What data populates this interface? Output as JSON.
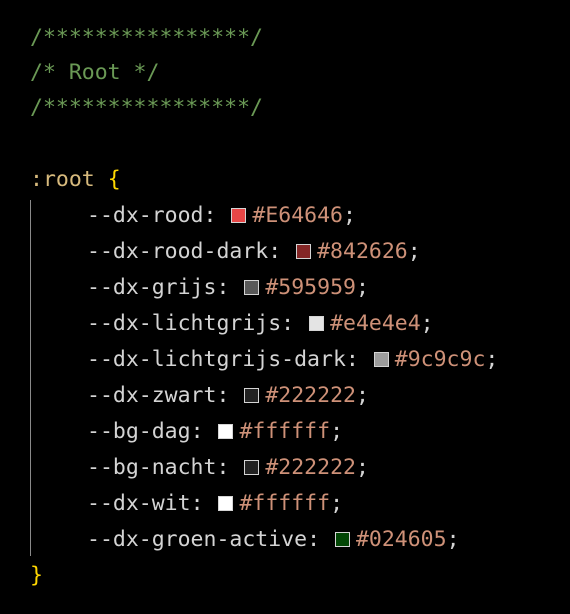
{
  "header_comments": [
    "/****************/",
    "/* Root */",
    "/****************/"
  ],
  "rule": {
    "selector": ":root",
    "open_brace": "{",
    "close_brace": "}"
  },
  "declarations": [
    {
      "property": "--dx-rood",
      "value": "#E64646",
      "color": "#E64646"
    },
    {
      "property": "--dx-rood-dark",
      "value": "#842626",
      "color": "#842626"
    },
    {
      "property": "--dx-grijs",
      "value": "#595959",
      "color": "#595959"
    },
    {
      "property": "--dx-lichtgrijs",
      "value": "#e4e4e4",
      "color": "#e4e4e4"
    },
    {
      "property": "--dx-lichtgrijs-dark",
      "value": "#9c9c9c",
      "color": "#9c9c9c"
    },
    {
      "property": "--dx-zwart",
      "value": "#222222",
      "color": "#222222"
    },
    {
      "property": "--bg-dag",
      "value": "#ffffff",
      "color": "#ffffff"
    },
    {
      "property": "--bg-nacht",
      "value": "#222222",
      "color": "#222222"
    },
    {
      "property": "--dx-wit",
      "value": "#ffffff",
      "color": "#ffffff"
    },
    {
      "property": "--dx-groen-active",
      "value": "#024605",
      "color": "#024605"
    }
  ],
  "colors": {
    "background": "#000000",
    "comment": "#6a9955",
    "selector": "#d7ba7d",
    "brace": "#ffd700",
    "property": "#d4d4d4",
    "value": "#ce9178"
  }
}
